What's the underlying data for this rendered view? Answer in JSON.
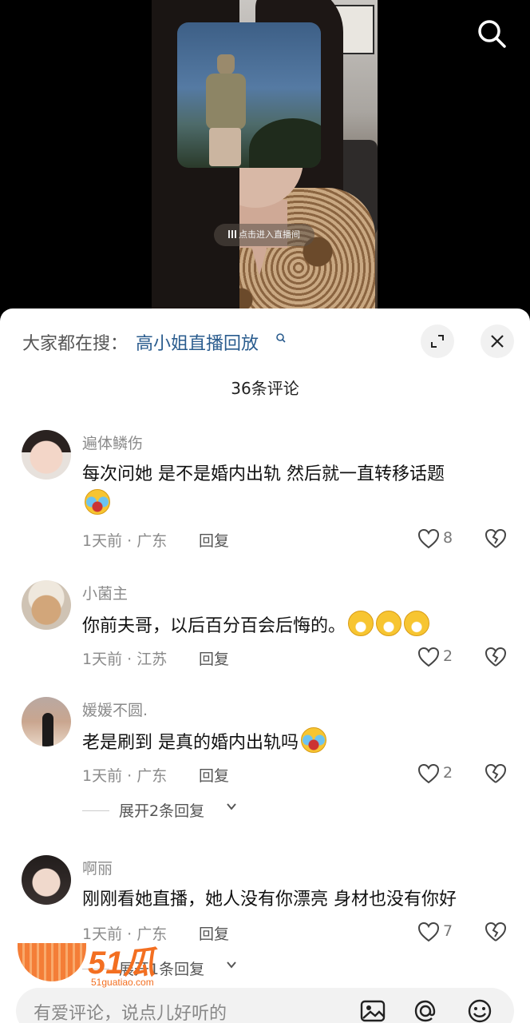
{
  "video": {
    "live_prompt": "点击进入直播间"
  },
  "sheet": {
    "trending_prefix": "大家都在搜：",
    "trending_query": "高小姐直播回放",
    "comment_count_label": "36条评论"
  },
  "comments": [
    {
      "username": "遍体鳞伤",
      "text": "每次问她 是不是婚内出轨  然后就一直转移话题",
      "emoji": "cry-laugh-emoji",
      "time_location": "1天前 · 广东",
      "reply_label": "回复",
      "likes": "8"
    },
    {
      "username": "小菌主",
      "text": "你前夫哥，以后百分百会后悔的。",
      "emoji": "grin-emoji",
      "time_location": "1天前 · 江苏",
      "reply_label": "回复",
      "likes": "2"
    },
    {
      "username": "媛媛不圆.",
      "text": "老是刷到 是真的婚内出轨吗",
      "emoji": "sweat-emoji",
      "time_location": "1天前 · 广东",
      "reply_label": "回复",
      "likes": "2",
      "expand_label": "展开2条回复"
    },
    {
      "username": "啊丽",
      "text": "刚刚看她直播，她人没有你漂亮 身材也没有你好",
      "time_location": "1天前 · 广东",
      "reply_label": "回复",
      "likes": "7",
      "expand_label": "展开1条回复"
    }
  ],
  "watermark": {
    "brand": "51瓜条",
    "url": "51guatiao.com"
  },
  "input": {
    "placeholder": "有爱评论，说点儿好听的"
  },
  "icons": {
    "search": "search-icon",
    "expand": "expand-icon",
    "close": "close-icon",
    "like": "heart-icon",
    "dislike": "broken-heart-icon",
    "image": "image-icon",
    "mention": "at-icon",
    "emoji": "smiley-icon"
  },
  "colors": {
    "link": "#2a5c8e",
    "watermark": "#f36f21"
  }
}
